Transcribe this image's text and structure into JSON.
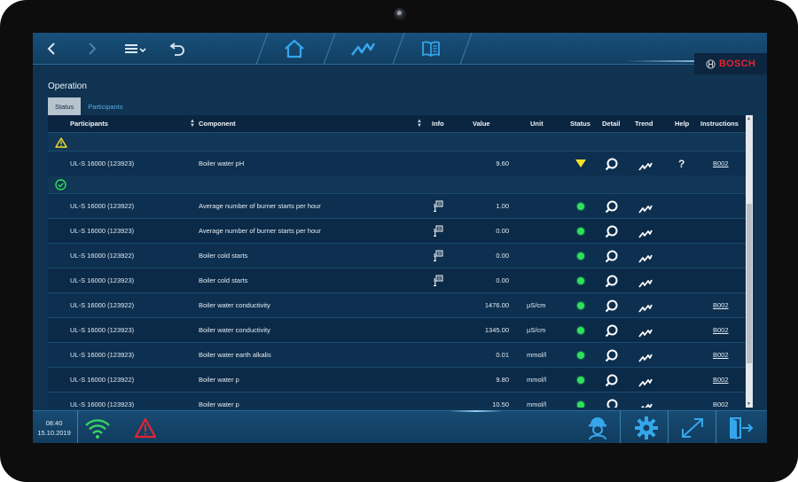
{
  "app": {
    "brand": "BOSCH"
  },
  "nav": {
    "icons": [
      "chevron-left-icon",
      "chevron-right-icon",
      "menu-icon",
      "undo-icon",
      "home-icon",
      "trend-icon",
      "book-icon"
    ]
  },
  "page": {
    "title": "Operation"
  },
  "tabs": [
    {
      "label": "Status",
      "active": true
    },
    {
      "label": "Participants",
      "active": false
    }
  ],
  "table": {
    "columns": [
      "Participants",
      "Component",
      "Info",
      "Value",
      "Unit",
      "Status",
      "Detail",
      "Trend",
      "Help",
      "Instructions"
    ],
    "groups": [
      {
        "status": "warning",
        "rows": [
          {
            "participant": "UL-S 16000 (123923)",
            "component": "Boiler water pH",
            "info": false,
            "value": "9.60",
            "unit": "",
            "status": "warning",
            "help": "?",
            "instructions": "B002"
          }
        ]
      },
      {
        "status": "ok",
        "rows": [
          {
            "participant": "UL-S 16000 (123922)",
            "component": "Average number of burner starts per hour",
            "info": true,
            "value": "1.00",
            "unit": "",
            "status": "ok",
            "help": "",
            "instructions": ""
          },
          {
            "participant": "UL-S 16000 (123923)",
            "component": "Average number of burner starts per hour",
            "info": true,
            "value": "0.00",
            "unit": "",
            "status": "ok",
            "help": "",
            "instructions": ""
          },
          {
            "participant": "UL-S 16000 (123922)",
            "component": "Boiler cold starts",
            "info": true,
            "value": "0.00",
            "unit": "",
            "status": "ok",
            "help": "",
            "instructions": ""
          },
          {
            "participant": "UL-S 16000 (123923)",
            "component": "Boiler cold starts",
            "info": true,
            "value": "0.00",
            "unit": "",
            "status": "ok",
            "help": "",
            "instructions": ""
          },
          {
            "participant": "UL-S 16000 (123922)",
            "component": "Boiler water conductivity",
            "info": false,
            "value": "1476.00",
            "unit": "µS/cm",
            "status": "ok",
            "help": "",
            "instructions": "B002"
          },
          {
            "participant": "UL-S 16000 (123923)",
            "component": "Boiler water conductivity",
            "info": false,
            "value": "1345.00",
            "unit": "µS/cm",
            "status": "ok",
            "help": "",
            "instructions": "B002"
          },
          {
            "participant": "UL-S 16000 (123923)",
            "component": "Boiler water earth alkalis",
            "info": false,
            "value": "0.01",
            "unit": "mmol/l",
            "status": "ok",
            "help": "",
            "instructions": "B002"
          },
          {
            "participant": "UL-S 16000 (123922)",
            "component": "Boiler water p",
            "info": false,
            "value": "9.80",
            "unit": "mmol/l",
            "status": "ok",
            "help": "",
            "instructions": "B002"
          },
          {
            "participant": "UL-S 16000 (123923)",
            "component": "Boiler water p",
            "info": false,
            "value": "10.50",
            "unit": "mmol/l",
            "status": "ok",
            "help": "",
            "instructions": "B002"
          }
        ]
      }
    ]
  },
  "footer": {
    "time": "08:40",
    "date": "15.10.2019",
    "icons": [
      "wifi-icon",
      "alarm-warning-icon",
      "user-service-icon",
      "settings-gear-icon",
      "fullscreen-icon",
      "logout-icon"
    ]
  },
  "colors": {
    "warning": "#f2e12a",
    "ok": "#2ee05a",
    "alarm": "#e8222e",
    "accent": "#2f9be0"
  }
}
